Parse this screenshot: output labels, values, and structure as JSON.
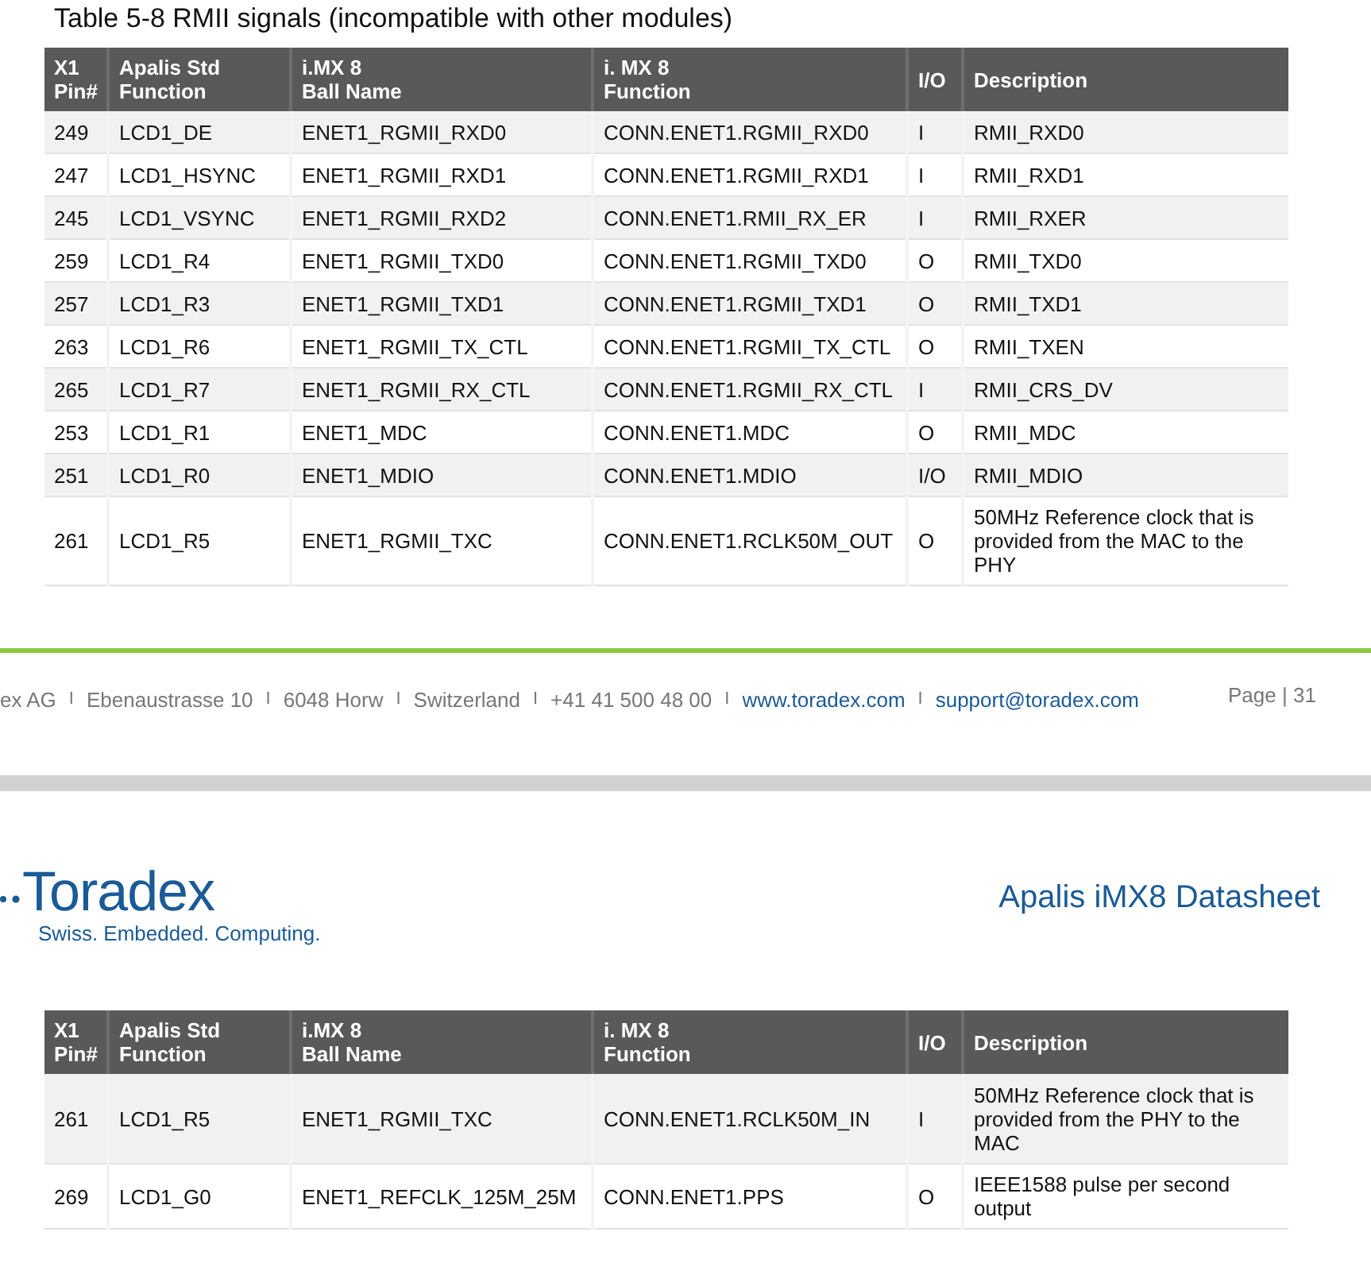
{
  "pages": [
    {
      "caption": "Table 5-8 RMII signals (incompatible with other modules)",
      "table": {
        "columns": [
          "X1\nPin#",
          "Apalis Std\nFunction",
          "i.MX 8\nBall Name",
          "i. MX 8\nFunction",
          "I/O",
          "Description"
        ],
        "rows": [
          [
            "249",
            "LCD1_DE",
            "ENET1_RGMII_RXD0",
            "CONN.ENET1.RGMII_RXD0",
            "I",
            "RMII_RXD0"
          ],
          [
            "247",
            "LCD1_HSYNC",
            "ENET1_RGMII_RXD1",
            "CONN.ENET1.RGMII_RXD1",
            "I",
            "RMII_RXD1"
          ],
          [
            "245",
            "LCD1_VSYNC",
            "ENET1_RGMII_RXD2",
            "CONN.ENET1.RMII_RX_ER",
            "I",
            "RMII_RXER"
          ],
          [
            "259",
            "LCD1_R4",
            "ENET1_RGMII_TXD0",
            "CONN.ENET1.RGMII_TXD0",
            "O",
            "RMII_TXD0"
          ],
          [
            "257",
            "LCD1_R3",
            "ENET1_RGMII_TXD1",
            "CONN.ENET1.RGMII_TXD1",
            "O",
            "RMII_TXD1"
          ],
          [
            "263",
            "LCD1_R6",
            "ENET1_RGMII_TX_CTL",
            "CONN.ENET1.RGMII_TX_CTL",
            "O",
            "RMII_TXEN"
          ],
          [
            "265",
            "LCD1_R7",
            "ENET1_RGMII_RX_CTL",
            "CONN.ENET1.RGMII_RX_CTL",
            "I",
            "RMII_CRS_DV"
          ],
          [
            "253",
            "LCD1_R1",
            "ENET1_MDC",
            "CONN.ENET1.MDC",
            "O",
            "RMII_MDC"
          ],
          [
            "251",
            "LCD1_R0",
            "ENET1_MDIO",
            "CONN.ENET1.MDIO",
            "I/O",
            "RMII_MDIO"
          ],
          [
            "261",
            "LCD1_R5",
            "ENET1_RGMII_TXC",
            "CONN.ENET1.RCLK50M_OUT",
            "O",
            "50MHz Reference clock that is provided from the MAC to the PHY"
          ]
        ]
      },
      "footer": {
        "items": [
          {
            "text": "ex AG",
            "kind": "plain"
          },
          {
            "text": "I",
            "kind": "separator"
          },
          {
            "text": "Ebenaustrasse 10",
            "kind": "plain"
          },
          {
            "text": "I",
            "kind": "separator"
          },
          {
            "text": "6048 Horw",
            "kind": "plain"
          },
          {
            "text": "I",
            "kind": "separator"
          },
          {
            "text": "Switzerland",
            "kind": "plain"
          },
          {
            "text": "I",
            "kind": "separator"
          },
          {
            "text": "+41 41 500 48 00",
            "kind": "plain"
          },
          {
            "text": "I",
            "kind": "separator"
          },
          {
            "text": "www.toradex.com",
            "kind": "link"
          },
          {
            "text": "I",
            "kind": "separator"
          },
          {
            "text": "support@toradex.com",
            "kind": "link"
          }
        ],
        "page": "Page | 31"
      }
    },
    {
      "logo": {
        "name": "Toradex",
        "tagline": "Swiss. Embedded. Computing."
      },
      "title": "Apalis iMX8 Datasheet",
      "table": {
        "columns": [
          "X1\nPin#",
          "Apalis Std\nFunction",
          "i.MX 8\nBall Name",
          "i. MX 8\nFunction",
          "I/O",
          "Description"
        ],
        "rows": [
          [
            "261",
            "LCD1_R5",
            "ENET1_RGMII_TXC",
            "CONN.ENET1.RCLK50M_IN",
            "I",
            "50MHz Reference clock that is provided from the PHY to the MAC"
          ],
          [
            "269",
            "LCD1_G0",
            "ENET1_REFCLK_125M_25M",
            "CONN.ENET1.PPS",
            "O",
            "IEEE1588 pulse per second output"
          ]
        ]
      }
    }
  ]
}
